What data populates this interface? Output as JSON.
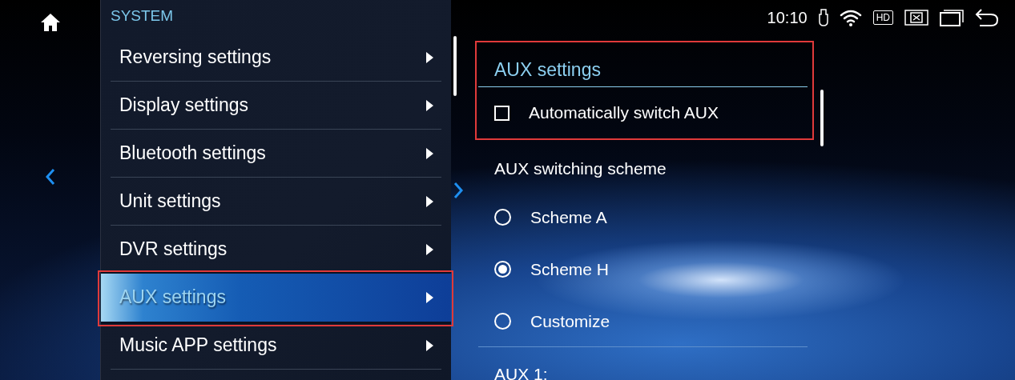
{
  "menu": {
    "header": "SYSTEM",
    "items": [
      {
        "label": "Reversing settings",
        "selected": false,
        "highlighted": false
      },
      {
        "label": "Display settings",
        "selected": false,
        "highlighted": false
      },
      {
        "label": "Bluetooth settings",
        "selected": false,
        "highlighted": false
      },
      {
        "label": "Unit settings",
        "selected": false,
        "highlighted": false
      },
      {
        "label": "DVR settings",
        "selected": false,
        "highlighted": false
      },
      {
        "label": "AUX settings",
        "selected": true,
        "highlighted": true
      },
      {
        "label": "Music APP settings",
        "selected": false,
        "highlighted": false
      }
    ]
  },
  "status_bar": {
    "time": "10:10",
    "hd_label": "HD"
  },
  "aux_panel": {
    "title": "AUX settings",
    "highlighted": true,
    "auto_switch": {
      "label": "Automatically switch AUX",
      "checked": false
    },
    "scheme": {
      "label": "AUX switching scheme",
      "options": [
        {
          "label": "Scheme A",
          "selected": false
        },
        {
          "label": "Scheme H",
          "selected": true
        },
        {
          "label": "Customize",
          "selected": false
        }
      ]
    },
    "aux1_label": "AUX 1:"
  }
}
